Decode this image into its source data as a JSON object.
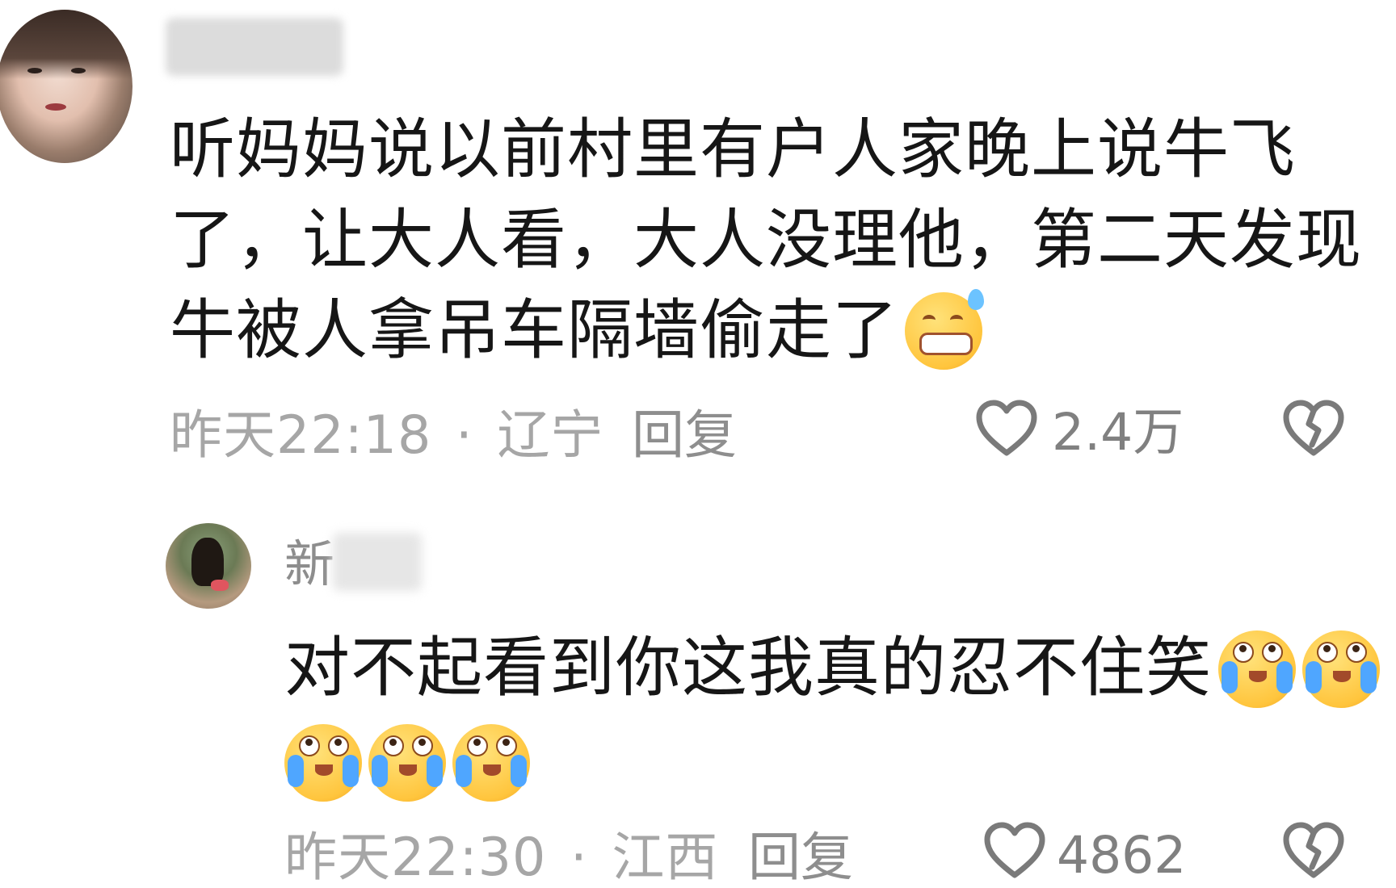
{
  "comments": [
    {
      "text": "听妈妈说以前村里有户人家晚上说牛飞\n了，让大人看，大人没理他，第二天发现\n牛被人拿吊车隔墙偷走了",
      "emoji": "grin-sweat-emoji",
      "time": "昨天22:18",
      "location": "辽宁",
      "reply_label": "回复",
      "likes": "2.4万"
    },
    {
      "user_prefix": "新",
      "text": "对不起看到你这我真的忍不住笑",
      "emojis": [
        "crying-laughing-emoji",
        "crying-laughing-emoji",
        "crying-laughing-emoji",
        "crying-laughing-emoji",
        "crying-laughing-emoji"
      ],
      "time": "昨天22:30",
      "location": "江西",
      "reply_label": "回复",
      "likes": "4862"
    }
  ],
  "separator": "·",
  "colors": {
    "meta_gray": "#a6a6a6",
    "icon_gray": "#7a7a7a",
    "text": "#161616"
  }
}
